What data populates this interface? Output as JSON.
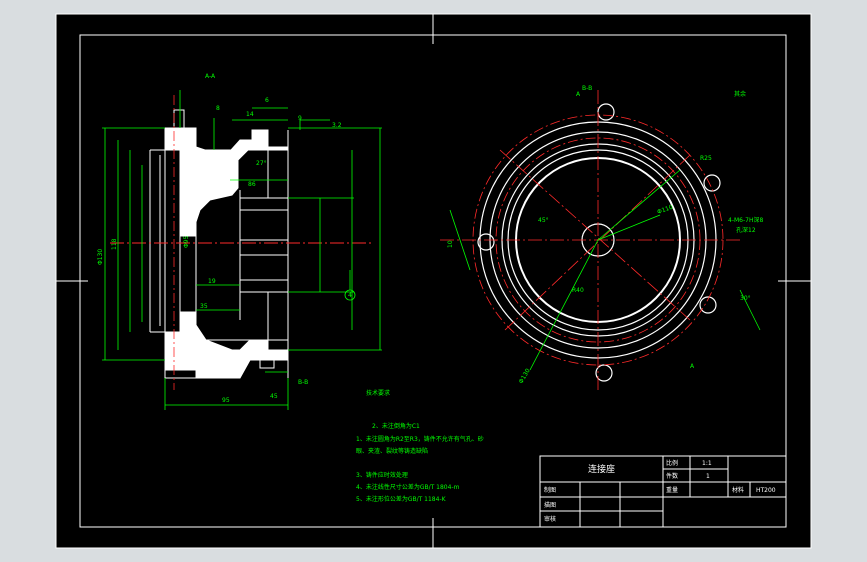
{
  "colors": {
    "outer_bg": "#d9dde0",
    "canvas": "#000000",
    "frame": "#ffffff",
    "part": "#ffffff",
    "dim": "#00ff00",
    "center": "#ff2a2a",
    "notes": "#00ff00",
    "title_text": "#ffffff",
    "cyan": "#00ffff"
  },
  "section_view": {
    "section_label": "A-A",
    "dims": {
      "d6": "6",
      "d14": "14",
      "d9": "9",
      "d8": "8",
      "ang": "27°",
      "d86": "86",
      "dia95": "Φ95",
      "dia130": "Φ130",
      "dia118": "118",
      "d19": "19",
      "d35": "35",
      "d45": "45",
      "d95b": "95",
      "rough": "3.2"
    },
    "bsection": "B-B",
    "balloon": "4"
  },
  "plan_view": {
    "section_label": "B-B",
    "cut_label_a": "A",
    "cut_label_b": "A",
    "corner_rough": "其余",
    "dims": {
      "r25": "R25",
      "dia110": "Φ110",
      "holes": "4-M6-7H深8",
      "holes2": "孔深12",
      "d10": "10",
      "ang45": "45°",
      "ang30": "30°",
      "r40": "R40",
      "dia130": "Φ130"
    }
  },
  "notes": {
    "title": "技术要求",
    "lines": [
      "2、未注倒角为C1",
      "1、未注圆角为R2至R3，铸件不允许有气孔、砂",
      "眼、夹渣、裂纹等铸造缺陷",
      "3、铸件应时效处理",
      "4、未注线性尺寸公差为GB/T 1804-m",
      "5、未注形位公差为GB/T 1184-K"
    ]
  },
  "title_block": {
    "part_name": "连接座",
    "scale_label": "比例",
    "scale_value": "1:1",
    "qty_label": "件数",
    "qty_value": "1",
    "weight_label": "重量",
    "material_label": "材料",
    "material_value": "HT200",
    "drawn_label": "制图",
    "design_label": "描图",
    "check_label": "审核"
  }
}
